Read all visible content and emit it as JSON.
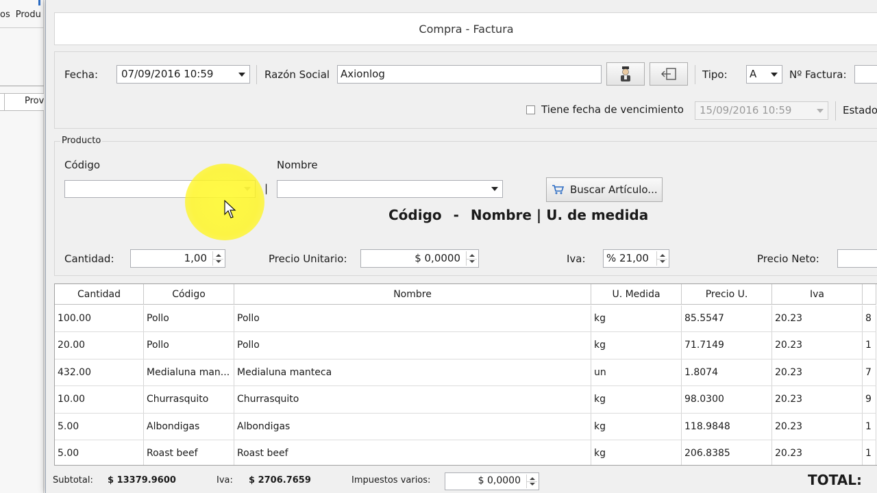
{
  "background_app": {
    "menu": [
      "os",
      "Produ"
    ],
    "column_header": "Prov"
  },
  "window": {
    "title": "Compra - Factura"
  },
  "header": {
    "fecha_label": "Fecha:",
    "fecha_value": "07/09/2016 10:59",
    "razon_label": "Razón Social",
    "razon_value": "Axionlog",
    "tipo_label": "Tipo:",
    "tipo_value": "A",
    "factura_label": "Nº Factura:",
    "vencimiento_label": "Tiene fecha de vencimiento",
    "vencimiento_checked": false,
    "vencimiento_value": "15/09/2016 10:59",
    "estado_label": "Estado"
  },
  "producto": {
    "group_label": "Producto",
    "codigo_label": "Código",
    "nombre_label": "Nombre",
    "pipe": "|",
    "buscar_label": "Buscar Artículo...",
    "summary_codigo": "Código",
    "summary_dash": "-",
    "summary_nombre": "Nombre | U. de medida",
    "cantidad_label": "Cantidad:",
    "cantidad_value": "1,00",
    "precio_label": "Precio Unitario:",
    "precio_value": "$ 0,0000",
    "iva_label": "Iva:",
    "iva_value": "% 21,00",
    "neto_label": "Precio Neto:"
  },
  "grid": {
    "columns": [
      "Cantidad",
      "Código",
      "Nombre",
      "U. Medida",
      "Precio U.",
      "Iva"
    ],
    "rows": [
      [
        "100.00",
        "Pollo",
        "Pollo",
        "kg",
        "85.5547",
        "20.23",
        "8"
      ],
      [
        "20.00",
        "Pollo",
        "Pollo",
        "kg",
        "71.7149",
        "20.23",
        "1"
      ],
      [
        "432.00",
        "Medialuna man...",
        "Medialuna manteca",
        "un",
        "1.8074",
        "20.23",
        "7"
      ],
      [
        "10.00",
        "Churrasquito",
        "Churrasquito",
        "kg",
        "98.0300",
        "20.23",
        "9"
      ],
      [
        "5.00",
        "Albondigas",
        "Albondigas",
        "kg",
        "118.9848",
        "20.23",
        "1"
      ],
      [
        "5.00",
        "Roast beef",
        "Roast beef",
        "kg",
        "206.8385",
        "20.23",
        "1"
      ]
    ]
  },
  "footer": {
    "subtotal_label": "Subtotal:",
    "subtotal_value": "$ 13379.9600",
    "iva_label": "Iva:",
    "iva_value": "$ 2706.7659",
    "impuestos_label": "Impuestos varios:",
    "impuestos_value": "$ 0,0000",
    "total_label": "TOTAL:"
  },
  "colors": {
    "highlight": "#fff732",
    "accent": "#2b6cc4"
  },
  "icons": [
    "user-icon",
    "login-icon",
    "cart-icon",
    "cursor-icon"
  ]
}
